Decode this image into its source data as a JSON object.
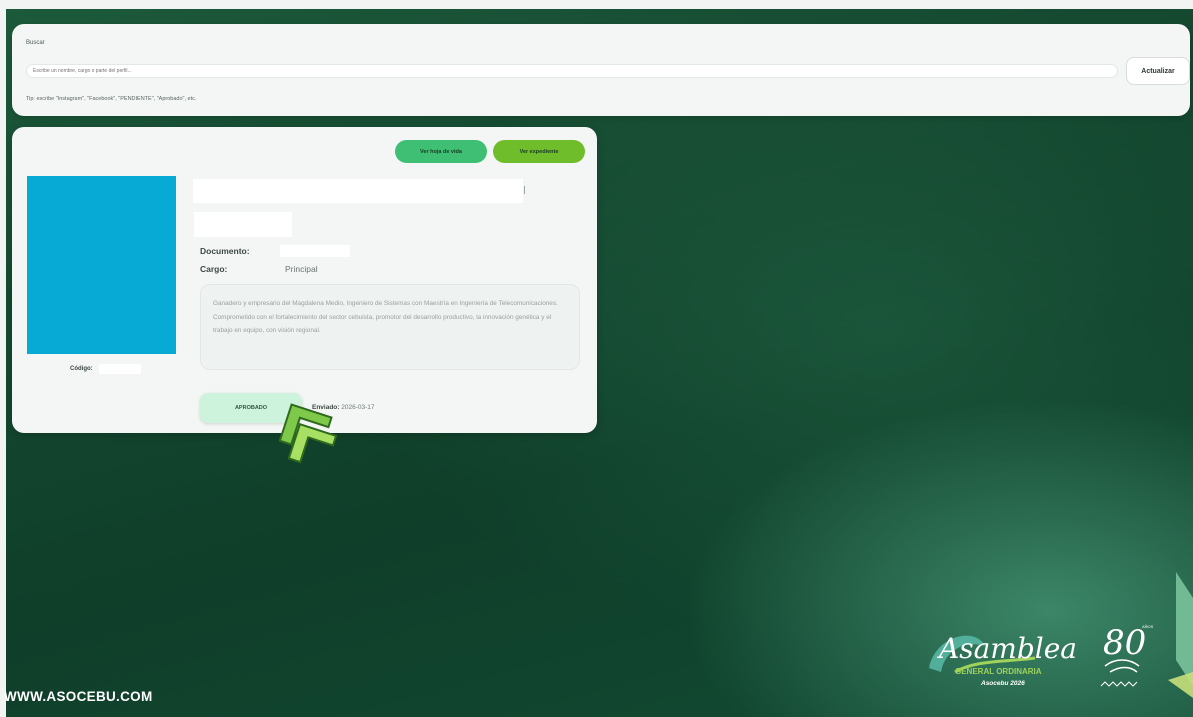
{
  "search": {
    "label": "Buscar",
    "placeholder": "Escribe un nombre, cargo o parte del perfil...",
    "refresh_label": "Actualizar",
    "tip": "Tip: escribe \"Instagram\", \"Facebook\", \"PENDIENTE\", \"Aprobado\", etc."
  },
  "profile": {
    "btn_sheet": "Ver hoja de vida",
    "btn_file": "Ver expediente",
    "code_label": "Código:",
    "document_label": "Documento:",
    "cargo_label": "Cargo:",
    "cargo_value": "Principal",
    "bio": "Ganadero y empresario del Magdalena Medio, Ingeniero de Sistemas con Maestría en Ingeniería de Telecomunicaciones. Comprometido con el fortalecimiento del sector cebuista, promotor del desarrollo productivo, la innovación genética y el trabajo en equipo, con visión regional.",
    "status": "APROBADO",
    "sent_label": "Enviado:",
    "sent_value": "2026-03-17"
  },
  "footer": {
    "url": "WWW.ASOCEBU.COM",
    "logo_script": "Asamblea",
    "logo_line1": "GENERAL ORDINARIA",
    "logo_line2": "Asocebu 2026",
    "anniv_number": "80",
    "anniv_word": "AÑOS"
  },
  "colors": {
    "accent_green": "#3fbf74",
    "lime": "#6fbd2a",
    "photo_blue": "#06aad4",
    "background": "#154a31"
  }
}
